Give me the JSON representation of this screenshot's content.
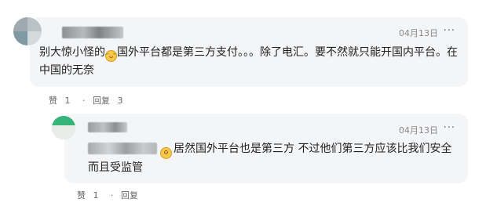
{
  "comments": [
    {
      "date": "04月13日",
      "more": "···",
      "text_before_emoji": "别大惊小怪的",
      "emoji": "laughing-face",
      "text_after_emoji": "国外平台都是第三方支付。。。除了电汇。要不然就只能开国内平台。在中国的无奈",
      "like_label": "赞",
      "like_count": "1",
      "separator": "·",
      "reply_label": "回复",
      "reply_count": "3"
    },
    {
      "date": "04月13日",
      "more": "···",
      "emoji": "surprised-face",
      "text": "居然国外平台也是第三方 不过他们第三方应该比我们安全 而且受监管",
      "like_label": "赞",
      "like_count": "1",
      "separator": "·",
      "reply_label": "回复"
    }
  ],
  "colors": {
    "bubble_bg": "#f4f5f7",
    "meta_text": "#888888",
    "body_text": "#1f1f1f"
  }
}
